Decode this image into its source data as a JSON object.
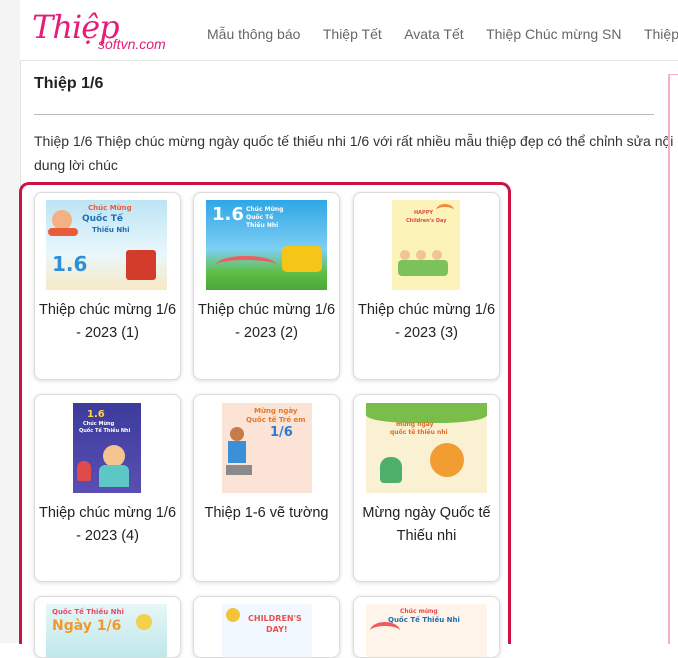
{
  "logo": {
    "main": "Thiệp",
    "sub": "softvn.com"
  },
  "nav": [
    {
      "label": "Mẫu thông báo"
    },
    {
      "label": "Thiệp Tết"
    },
    {
      "label": "Avata Tết"
    },
    {
      "label": "Thiệp Chúc mừng SN"
    },
    {
      "label": "Thiệp c"
    }
  ],
  "page": {
    "title": "Thiệp 1/6",
    "description": "Thiệp 1/6 Thiệp chúc mừng ngày quốc tế thiếu nhi 1/6 với rất nhiều mẫu thiệp đẹp có thể chỉnh sửa nội dung lời chúc"
  },
  "cards": [
    {
      "title": "Thiệp chúc mừng 1/6 - 2023 (1)",
      "thumb": {
        "line1": "Chúc Mừng",
        "line2": "Quốc Tế",
        "line3": "Thiếu Nhi",
        "big": "1.6"
      }
    },
    {
      "title": "Thiệp chúc mừng 1/6 - 2023 (2)",
      "thumb": {
        "big": "1.6",
        "line1": "Chúc Mừng",
        "line2": "Quốc Tế",
        "line3": "Thiếu Nhi"
      }
    },
    {
      "title": "Thiệp chúc mừng 1/6 - 2023 (3)",
      "thumb": {
        "line1": "HAPPY",
        "line2": "Children's Day"
      }
    },
    {
      "title": "Thiệp chúc mừng 1/6 - 2023 (4)",
      "thumb": {
        "big": "1.6",
        "line1": "Chúc Mừng",
        "line2": "Quốc Tế Thiếu Nhi"
      }
    },
    {
      "title": "Thiệp 1-6 vẽ tường",
      "thumb": {
        "line1": "Mừng ngày",
        "line2": "Quốc tế Trẻ em",
        "big": "1/6"
      }
    },
    {
      "title": "Mừng ngày Quốc tế Thiếu nhi",
      "thumb": {
        "line1": "mừng ngày",
        "line2": "quốc tế thiếu nhi"
      }
    },
    {
      "title": "",
      "thumb": {
        "line1": "Quốc Tế Thiếu Nhi",
        "big": "Ngày 1/6"
      }
    },
    {
      "title": "",
      "thumb": {
        "line1": "CHILDREN'S",
        "line2": "DAY!"
      }
    },
    {
      "title": "",
      "thumb": {
        "line1": "Chúc mừng",
        "line2": "Quốc Tế Thiếu Nhi"
      }
    }
  ],
  "colors": {
    "brand": "#e51c79",
    "highlight": "#cc1240"
  }
}
